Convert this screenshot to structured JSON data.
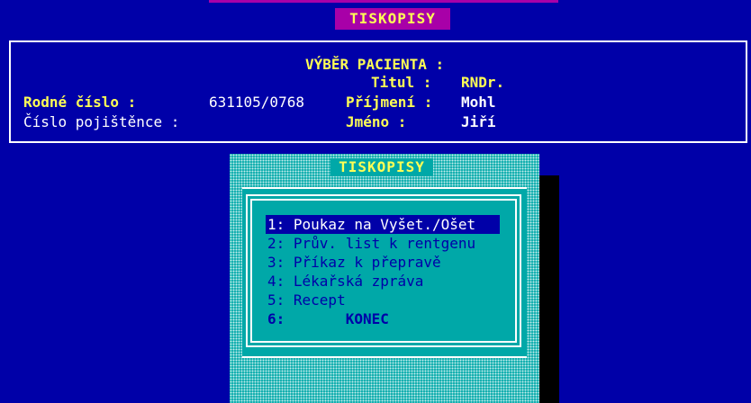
{
  "header": {
    "title": "TISKOPISY"
  },
  "patient": {
    "heading": "VÝBĚR PACIENTA :",
    "titul_label": "Titul :",
    "titul_value": "RNDr.",
    "rodne_cislo_label": "Rodné číslo :",
    "rodne_cislo_value": "631105/0768",
    "prijmeni_label": "Příjmení :",
    "prijmeni_value": "Mohl",
    "cislo_pojistence_label": "Číslo pojištěnce :",
    "cislo_pojistence_value": "",
    "jmeno_label": "Jméno :",
    "jmeno_value": "Jiří"
  },
  "menu": {
    "title": "TISKOPISY",
    "selected_index": 0,
    "items": [
      {
        "label": "1: Poukaz na Vyšet./Ošet"
      },
      {
        "label": "2: Prův. list k rentgenu"
      },
      {
        "label": "3: Příkaz k přepravě"
      },
      {
        "label": "4: Lékařská zpráva"
      },
      {
        "label": "5: Recept"
      },
      {
        "label": "6:       KONEC"
      }
    ]
  },
  "colors": {
    "background": "#0000a8",
    "title_bar": "#a800a8",
    "label_text": "#ffff55",
    "value_text": "#ffffff",
    "menu_bg": "#00a8a8",
    "menu_text": "#0000a8"
  }
}
